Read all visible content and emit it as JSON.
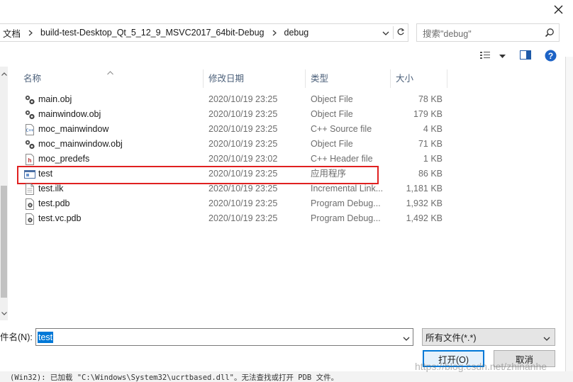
{
  "window": {
    "close_symbol": "✕"
  },
  "address_bar": {
    "breadcrumbs": [
      "文档",
      "build-test-Desktop_Qt_5_12_9_MSVC2017_64bit-Debug",
      "debug"
    ]
  },
  "search": {
    "placeholder": "搜索\"debug\""
  },
  "columns": {
    "name": "名称",
    "date": "修改日期",
    "type": "类型",
    "size": "大小"
  },
  "files": [
    {
      "name": "main.obj",
      "date": "2020/10/19 23:25",
      "type": "Object File",
      "size": "78 KB",
      "icon": "obj-file-icon"
    },
    {
      "name": "mainwindow.obj",
      "date": "2020/10/19 23:25",
      "type": "Object File",
      "size": "179 KB",
      "icon": "obj-file-icon"
    },
    {
      "name": "moc_mainwindow",
      "date": "2020/10/19 23:25",
      "type": "C++ Source file",
      "size": "4 KB",
      "icon": "cpp-file-icon"
    },
    {
      "name": "moc_mainwindow.obj",
      "date": "2020/10/19 23:25",
      "type": "Object File",
      "size": "71 KB",
      "icon": "obj-file-icon"
    },
    {
      "name": "moc_predefs",
      "date": "2020/10/19 23:02",
      "type": "C++ Header file",
      "size": "1 KB",
      "icon": "header-file-icon"
    },
    {
      "name": "test",
      "date": "2020/10/19 23:25",
      "type": "应用程序",
      "size": "86 KB",
      "icon": "exe-file-icon",
      "highlighted": true
    },
    {
      "name": "test.ilk",
      "date": "2020/10/19 23:25",
      "type": "Incremental Link...",
      "size": "1,181 KB",
      "icon": "ilk-file-icon"
    },
    {
      "name": "test.pdb",
      "date": "2020/10/19 23:25",
      "type": "Program Debug...",
      "size": "1,932 KB",
      "icon": "pdb-file-icon"
    },
    {
      "name": "test.vc.pdb",
      "date": "2020/10/19 23:25",
      "type": "Program Debug...",
      "size": "1,492 KB",
      "icon": "pdb-file-icon"
    }
  ],
  "filename": {
    "label": "件名(N):",
    "value": "test"
  },
  "filetype": {
    "value": "所有文件(*.*)"
  },
  "buttons": {
    "open": "打开(O)",
    "cancel": "取消"
  },
  "background_log": "(Win32): 已加载 \"C:\\Windows\\System32\\ucrtbased.dll\"。无法查找或打开 PDB 文件。",
  "watermark": "https://blog.csdn.net/zhinanhe",
  "colors": {
    "accent": "#0078d7",
    "highlight_border": "#e02020",
    "header_text": "#4c607a"
  }
}
